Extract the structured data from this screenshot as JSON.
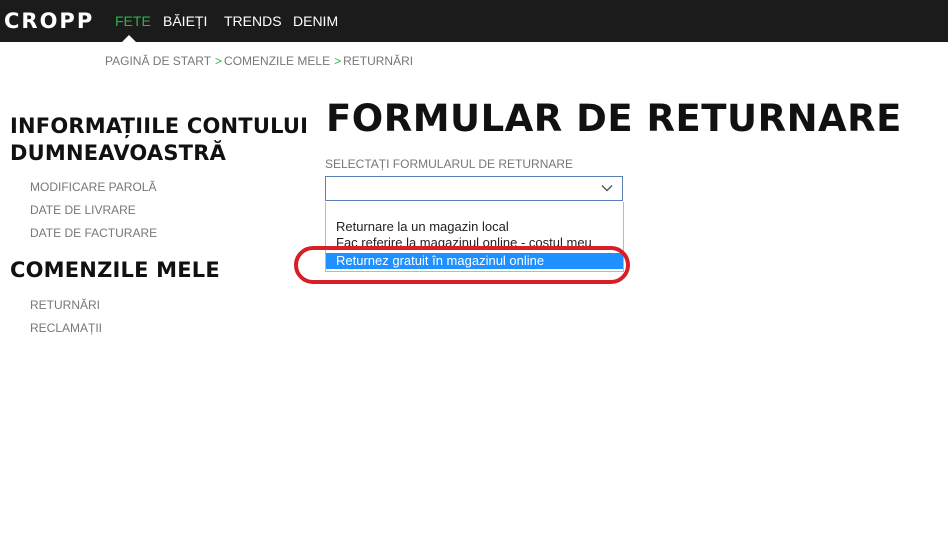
{
  "header": {
    "logo": "CROPP",
    "nav": [
      {
        "label": "FETE",
        "active": true
      },
      {
        "label": "BĂIEȚI",
        "active": false
      },
      {
        "label": "TRENDS",
        "active": false
      },
      {
        "label": "DENIM",
        "active": false
      }
    ]
  },
  "breadcrumb": {
    "items": [
      "PAGINĂ DE START",
      "COMENZILE MELE",
      "RETURNĂRI"
    ],
    "separator": ">"
  },
  "sidebar": {
    "account_heading_line1": "INFORMAȚIILE CONTULUI",
    "account_heading_line2": "DUMNEAVOASTRĂ",
    "account_links": [
      "MODIFICARE PAROLĂ",
      "DATE DE LIVRARE",
      "DATE DE FACTURARE"
    ],
    "orders_heading": "COMENZILE MELE",
    "orders_links": [
      "RETURNĂRI",
      "RECLAMAȚII"
    ]
  },
  "main": {
    "title": "FORMULAR DE RETURNARE",
    "select_label": "SELECTAȚI FORMULARUL DE RETURNARE",
    "select_value": "",
    "options": [
      "Returnare la un magazin local",
      "Fac referire la magazinul online - costul meu",
      "Returnez gratuit în magazinul online"
    ],
    "selected_option_index": 2
  },
  "colors": {
    "topbar": "#1b1b1b",
    "accent_green": "#2fb34a",
    "selection_blue": "#1e90ff",
    "annotation_red": "#d61f26"
  }
}
